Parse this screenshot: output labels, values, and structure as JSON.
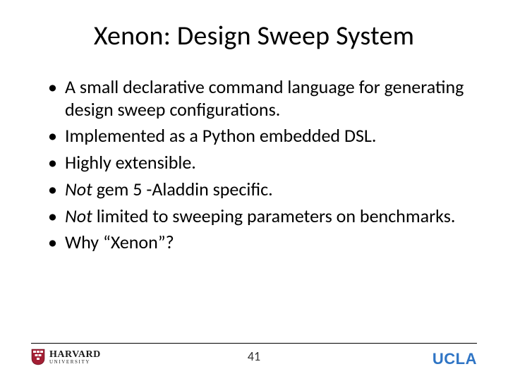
{
  "title": "Xenon: Design Sweep System",
  "bullets": [
    {
      "pre": "",
      "em": "",
      "post": "A small declarative command language for generating design sweep configurations."
    },
    {
      "pre": "",
      "em": "",
      "post": "Implemented as a Python embedded DSL."
    },
    {
      "pre": "",
      "em": "",
      "post": "Highly extensible."
    },
    {
      "pre": "",
      "em": "Not",
      "post": " gem 5 -Aladdin specific."
    },
    {
      "pre": "",
      "em": "Not",
      "post": " limited to sweeping parameters on benchmarks."
    },
    {
      "pre": "",
      "em": "",
      "post": "Why “Xenon”?"
    }
  ],
  "page_number": "41",
  "logos": {
    "harvard_top": "HARVARD",
    "harvard_bottom": "UNIVERSITY",
    "ucla": "UCLA"
  },
  "colors": {
    "harvard_crimson": "#a31f34",
    "ucla_blue": "#2f75c5"
  }
}
